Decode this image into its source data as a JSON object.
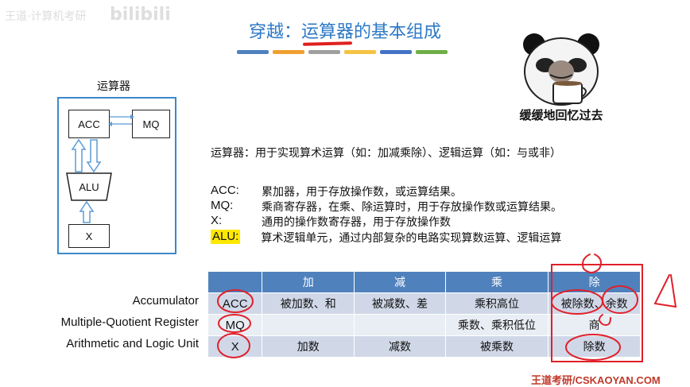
{
  "watermark": {
    "text": "王道·计算机考研",
    "logo": "bilibili"
  },
  "title": {
    "prefix": "穿越：",
    "highlight": "运算器",
    "suffix": "的基本组成"
  },
  "title_bar_colors": [
    "#4f81bd",
    "#f0a030",
    "#a0a0a0",
    "#f6c343",
    "#4472c4",
    "#70ad47"
  ],
  "meme": {
    "caption": "缓缓地回忆过去"
  },
  "diagram": {
    "title": "运算器",
    "acc": "ACC",
    "mq": "MQ",
    "alu": "ALU",
    "x": "X"
  },
  "description": {
    "intro": "运算器：用于实现算术运算（如：加减乘除）、逻辑运算（如：与或非）",
    "items": [
      {
        "key": "ACC:",
        "text": "累加器，用于存放操作数，或运算结果。"
      },
      {
        "key": "MQ:",
        "text": "乘商寄存器，在乘、除运算时，用于存放操作数或运算结果。"
      },
      {
        "key": "X:",
        "text": "通用的操作数寄存器，用于存放操作数"
      },
      {
        "key": "ALU:",
        "text": "算术逻辑单元，通过内部复杂的电路实现算数运算、逻辑运算"
      }
    ]
  },
  "table": {
    "headers": [
      "",
      "加",
      "减",
      "乘",
      "除"
    ],
    "rows": [
      {
        "label": "Accumulator",
        "cells": [
          "ACC",
          "被加数、和",
          "被减数、差",
          "乘积高位",
          "被除数、余数"
        ]
      },
      {
        "label": "Multiple-Quotient Register",
        "cells": [
          "MQ",
          "",
          "",
          "乘数、乘积低位",
          "商"
        ]
      },
      {
        "label": "Arithmetic and Logic Unit",
        "cells": [
          "X",
          "加数",
          "减数",
          "被乘数",
          "除数"
        ]
      }
    ]
  },
  "footer": {
    "text": "王道考研/CSKAOYAN.COM"
  }
}
